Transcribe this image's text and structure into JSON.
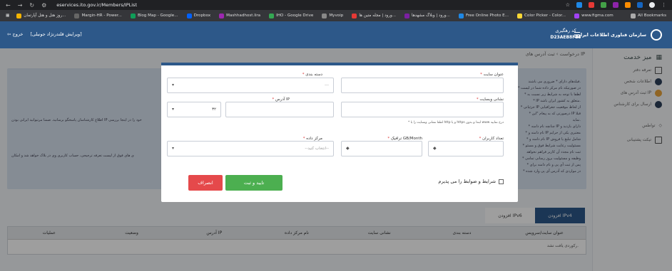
{
  "browser": {
    "url": "eservices.ito.gov.ir/Members/IPList",
    "bookmarks": [
      "روز هتل و هتل آپارتمان...",
      "Margin-HR - Power...",
      "Blog Map - Google...",
      "Dropbox",
      "Mashhadhost.lira",
      "IHO - Google Drive",
      "Myvoip",
      "ورود | مجله متین ها...",
      "ورود | وبلاگ مشهدها...",
      "Free Online Photo E...",
      "Color Picker - Color...",
      "www.figma.com"
    ],
    "all_bookmarks": "All Bookmarks"
  },
  "header": {
    "brand": "سازمان فناوری اطلاعات ایران",
    "user_name": "کد رهگیری",
    "user_code": "D23AEB8FE3",
    "logout": "خروج",
    "edit_company": "[ویرایش قلندرنژاد جونیلی]"
  },
  "sidebar": {
    "title": "میز خدمت",
    "items": [
      "تعرفه دفتر",
      "اطلاعات شخص",
      "ثبت آدرس های IP",
      "ارسال برای کارشناس",
      "تواطس",
      "تیکت پشتیبانی"
    ]
  },
  "breadcrumb": "درخواست › ثبت آدرس های IP",
  "notes": {
    "lines": [
      "فیلدهای دارای * ضروری می باشند.",
      "* در صورتیکه نام مرکز داده شما در لیست",
      "* لطفا با توجه به شرایط زیر نسبت به",
      "* IP متعلق به کشور ایران باشد.",
      "* جزئیاتی IP از لحاظ موقعیت جغرافیایی",
      "* درصورتی که به پیغام \"این IP قبلا",
      "نماید.",
      "* چنانچه نام دامنه IP دارای بازدید و",
      "* نام دامنه و IP معتبری یکی از حرایم",
      "* نام دامنه و IP شامل تبلیغ یا فروش",
      "* مسئولیت رعایت شرایط فوق و مسئو",
      "ثبت نام مجدد آن کاربر فراهم نخواهد",
      "* وظیفه و مسئولیت بروز رسانی تمامی",
      "* پس از ثبت آی پی و نام دامنه برای",
      "* در مواردی که آدرس آی پی وارد شده"
    ],
    "side_text_1": "اطلاع کارشناسان پاسخگو برسانید. ضمنا مرتبوانید ایرانی بودن IP خود را در اینجا بررسی",
    "side_text_2": "ی های فوق از لیست تعرفه ترجیحی، حساب کاربری وی در بلاک خواهد شد و امکان"
  },
  "tabs": [
    "افزودن IPv4",
    "افزودن IPv6"
  ],
  "table": {
    "headers": [
      "عنوان سایت/سرویس",
      "دسته بندی",
      "نشانی سایت",
      "نام مرکز داده",
      "آدرس IP",
      "وضعیت",
      "عملیات"
    ],
    "empty": "رکوردی یافت نشد."
  },
  "modal": {
    "site_title_label": "عنوان سایت",
    "category_label": "دسته بندی",
    "category_placeholder": "---",
    "site_url_label": "نشانی وبسایت",
    "ip_label": "آدرس IP",
    "ip_prefix": "۳۲",
    "url_hint": "* لطفا نشانی وبسایت را با http و یا https ابتدا و بدون www درج نمایید",
    "users_label": "تعداد کاربران",
    "traffic_label": "ترافیک GB/Month",
    "datacenter_label": "مرکز داده",
    "datacenter_placeholder": "--انتخاب کنید--",
    "agree_text": "شرایط و ضوابط را می پذیرم",
    "submit": "تایید و ثبت",
    "cancel": "انصراف"
  },
  "colors": {
    "primary": "#2d5889",
    "success": "#4caf50",
    "danger": "#e5494b"
  }
}
